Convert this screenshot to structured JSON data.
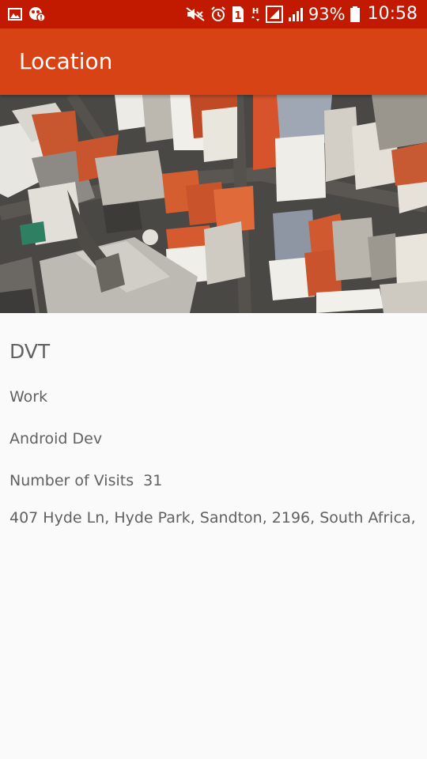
{
  "status_bar": {
    "battery_percent": "93%",
    "time": "10:58",
    "network_label": "H",
    "sim_label": "1",
    "left_icons": [
      "image-notification-icon",
      "app-alert-notification-icon"
    ],
    "right_icons": [
      "mute-icon",
      "alarm-icon",
      "sim-icon",
      "data-h-icon",
      "signal-boxed-icon",
      "signal-icon",
      "battery-icon"
    ]
  },
  "app_bar": {
    "title": "Location",
    "color": "#D84315"
  },
  "status_bar_color": "#C11A00",
  "hero_image": {
    "description_icon": "aerial-city-photo"
  },
  "details": {
    "name": "DVT",
    "type": "Work",
    "description": "Android Dev",
    "visits_label": "Number of Visits",
    "visits_count": "31",
    "address": "407 Hyde Ln, Hyde Park, Sandton, 2196, South Africa,"
  }
}
